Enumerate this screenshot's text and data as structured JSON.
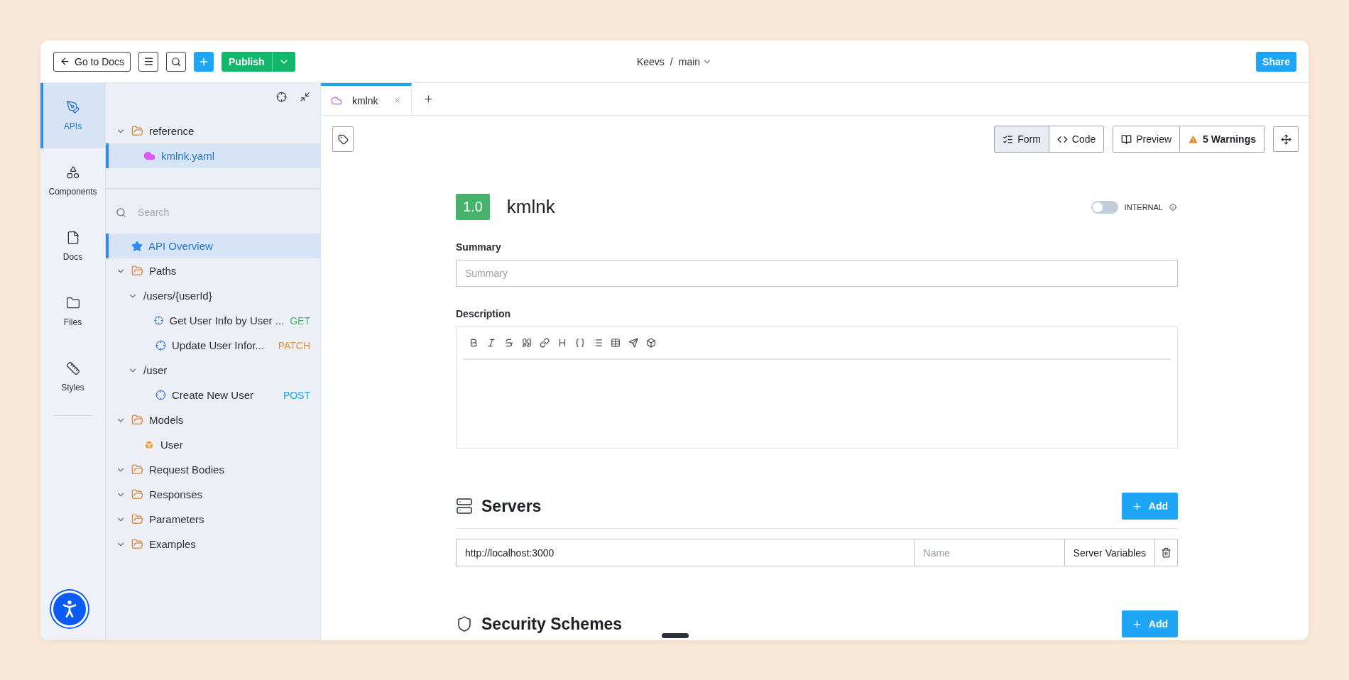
{
  "topbar": {
    "back": "Go to Docs",
    "publish": "Publish",
    "project": "Keevs",
    "separator": "/",
    "branch": "main",
    "share": "Share"
  },
  "rail": [
    {
      "label": "APIs",
      "kind": "apis",
      "selected": true
    },
    {
      "label": "Components",
      "kind": "components",
      "selected": false
    },
    {
      "label": "Docs",
      "kind": "docs",
      "selected": false
    },
    {
      "label": "Files",
      "kind": "files",
      "selected": false
    },
    {
      "label": "Styles",
      "kind": "styles",
      "selected": false
    }
  ],
  "files": [
    {
      "label": "reference",
      "kind": "folder",
      "expanded": true,
      "children": [
        {
          "label": "kmlnk.yaml",
          "kind": "file",
          "selected": true
        }
      ]
    }
  ],
  "search": {
    "placeholder": "Search"
  },
  "nav": [
    {
      "label": "API Overview",
      "kind": "overview",
      "selected": true
    },
    {
      "label": "Paths",
      "kind": "folder",
      "expanded": true,
      "children": [
        {
          "label": "/users/{userId}",
          "kind": "path",
          "expanded": true,
          "children": [
            {
              "label": "Get User Info by User ...",
              "kind": "operation",
              "method": "GET",
              "color": "#3dbb6c",
              "selected": false
            },
            {
              "label": "Update User Infor...",
              "kind": "operation",
              "method": "PATCH",
              "color": "#e8943a",
              "selected": false
            }
          ]
        },
        {
          "label": "/user",
          "kind": "path",
          "expanded": true,
          "children": [
            {
              "label": "Create New User",
              "kind": "operation",
              "method": "POST",
              "color": "#1ea5f5",
              "selected": false
            }
          ]
        }
      ]
    },
    {
      "label": "Models",
      "kind": "folder",
      "expanded": true,
      "children": [
        {
          "label": "User",
          "kind": "model",
          "selected": false
        }
      ]
    },
    {
      "label": "Request Bodies",
      "kind": "folder",
      "expanded": true
    },
    {
      "label": "Responses",
      "kind": "folder",
      "expanded": true
    },
    {
      "label": "Parameters",
      "kind": "folder",
      "expanded": true
    },
    {
      "label": "Examples",
      "kind": "folder",
      "expanded": true
    }
  ],
  "tabs": [
    {
      "label": "kmlnk",
      "selected": true
    }
  ],
  "views": [
    {
      "label": "Form",
      "kind": "form",
      "selected": true
    },
    {
      "label": "Code",
      "kind": "code",
      "selected": false
    }
  ],
  "preview": "Preview",
  "warnings": "5 Warnings",
  "api": {
    "version": "1.0",
    "title": "kmlnk",
    "internal": {
      "label": "INTERNAL",
      "on": false
    }
  },
  "summary": {
    "label": "Summary",
    "placeholder": "Summary"
  },
  "description": {
    "label": "Description"
  },
  "servers": {
    "title": "Servers",
    "add": "Add",
    "rows": [
      {
        "url": "http://localhost:3000",
        "name_placeholder": "Name",
        "variables": "Server Variables"
      }
    ]
  },
  "security": {
    "title": "Security Schemes",
    "add": "Add"
  }
}
